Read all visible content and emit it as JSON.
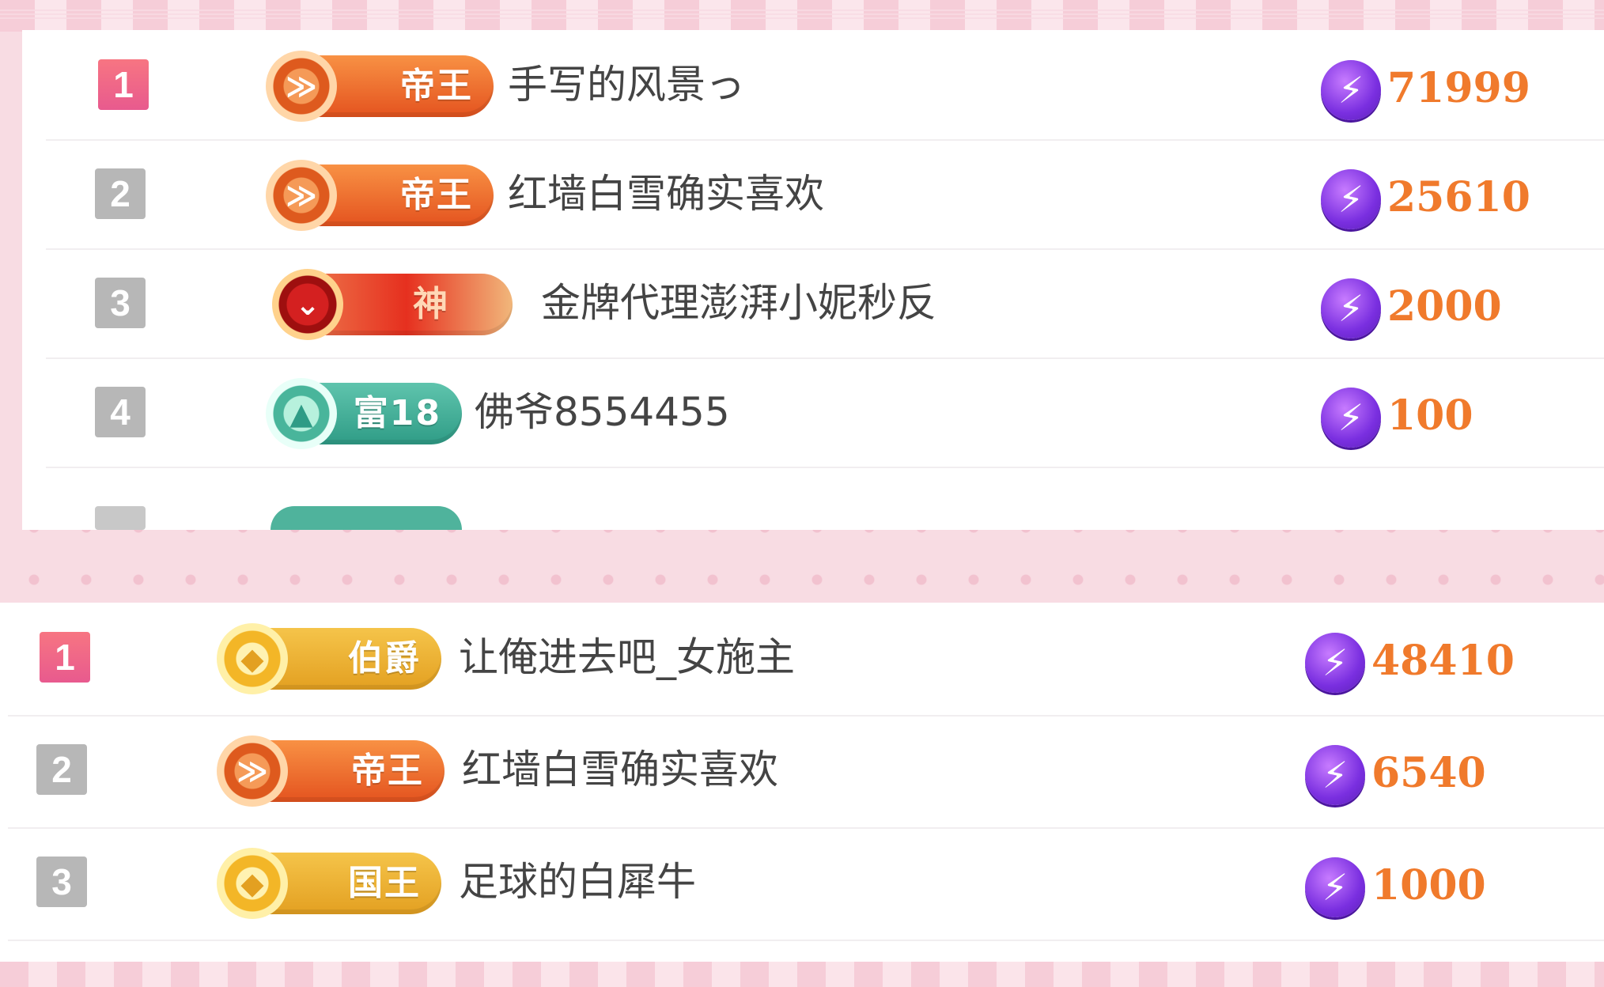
{
  "colors": {
    "accent_orange": "#f07a2c",
    "rank_gold": "#ee5f86",
    "rank_gray": "#b7b7b7",
    "bolt_purple": "#7a2fe0"
  },
  "icons": {
    "score": "lightning-bolt-icon"
  },
  "board_1": {
    "rows": [
      {
        "rank": "1",
        "badge": "帝王",
        "name": "手写的风景っ",
        "score": "71999"
      },
      {
        "rank": "2",
        "badge": "帝王",
        "name": "红墙白雪确实喜欢",
        "score": "25610"
      },
      {
        "rank": "3",
        "badge": "神",
        "name": "金牌代理澎湃小妮秒反",
        "score": "2000"
      },
      {
        "rank": "4",
        "badge": "富18",
        "name": "佛爷8554455",
        "score": "100"
      }
    ]
  },
  "board_2": {
    "rows": [
      {
        "rank": "1",
        "badge": "伯爵",
        "name": "让俺进去吧_女施主",
        "score": "48410"
      },
      {
        "rank": "2",
        "badge": "帝王",
        "name": "红墙白雪确实喜欢",
        "score": "6540"
      },
      {
        "rank": "3",
        "badge": "国王",
        "name": "足球的白犀牛",
        "score": "1000"
      }
    ]
  }
}
